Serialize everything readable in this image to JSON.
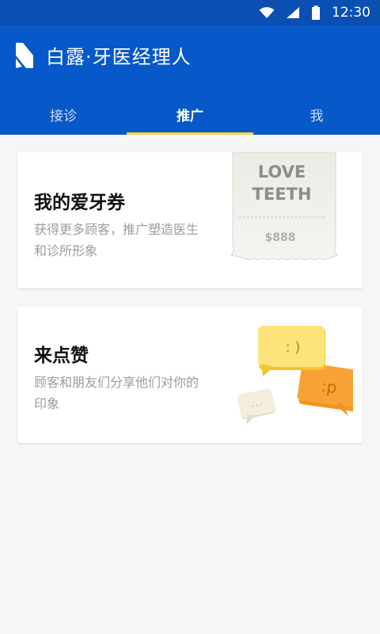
{
  "status_bar": {
    "time": "12:30",
    "icons": [
      "wifi-icon",
      "signal-icon",
      "battery-icon"
    ]
  },
  "app": {
    "title": "白露·牙医经理人",
    "logo": "bailu-logo"
  },
  "tabs": [
    {
      "label": "接诊",
      "active": false
    },
    {
      "label": "推广",
      "active": true
    },
    {
      "label": "我",
      "active": false
    }
  ],
  "cards": {
    "coupon": {
      "title": "我的爱牙券",
      "description": "获得更多顾客，推广塑造医生和诊所形象",
      "illustration": {
        "line1": "LOVE",
        "line2": "TEETH",
        "price": "$888"
      }
    },
    "like": {
      "title": "来点赞",
      "description": "顾客和朋友们分享他们对你的印象",
      "illustration": {
        "bubble_yellow": ": )",
        "bubble_orange": ":p",
        "bubble_small": "…"
      }
    }
  },
  "colors": {
    "status_bar": "#0a4fb1",
    "app_bar": "#0758c8",
    "tab_indicator": "#f7d447",
    "background": "#f6f6f6",
    "bubble_yellow": "#fde47a",
    "bubble_orange": "#f7a035"
  }
}
